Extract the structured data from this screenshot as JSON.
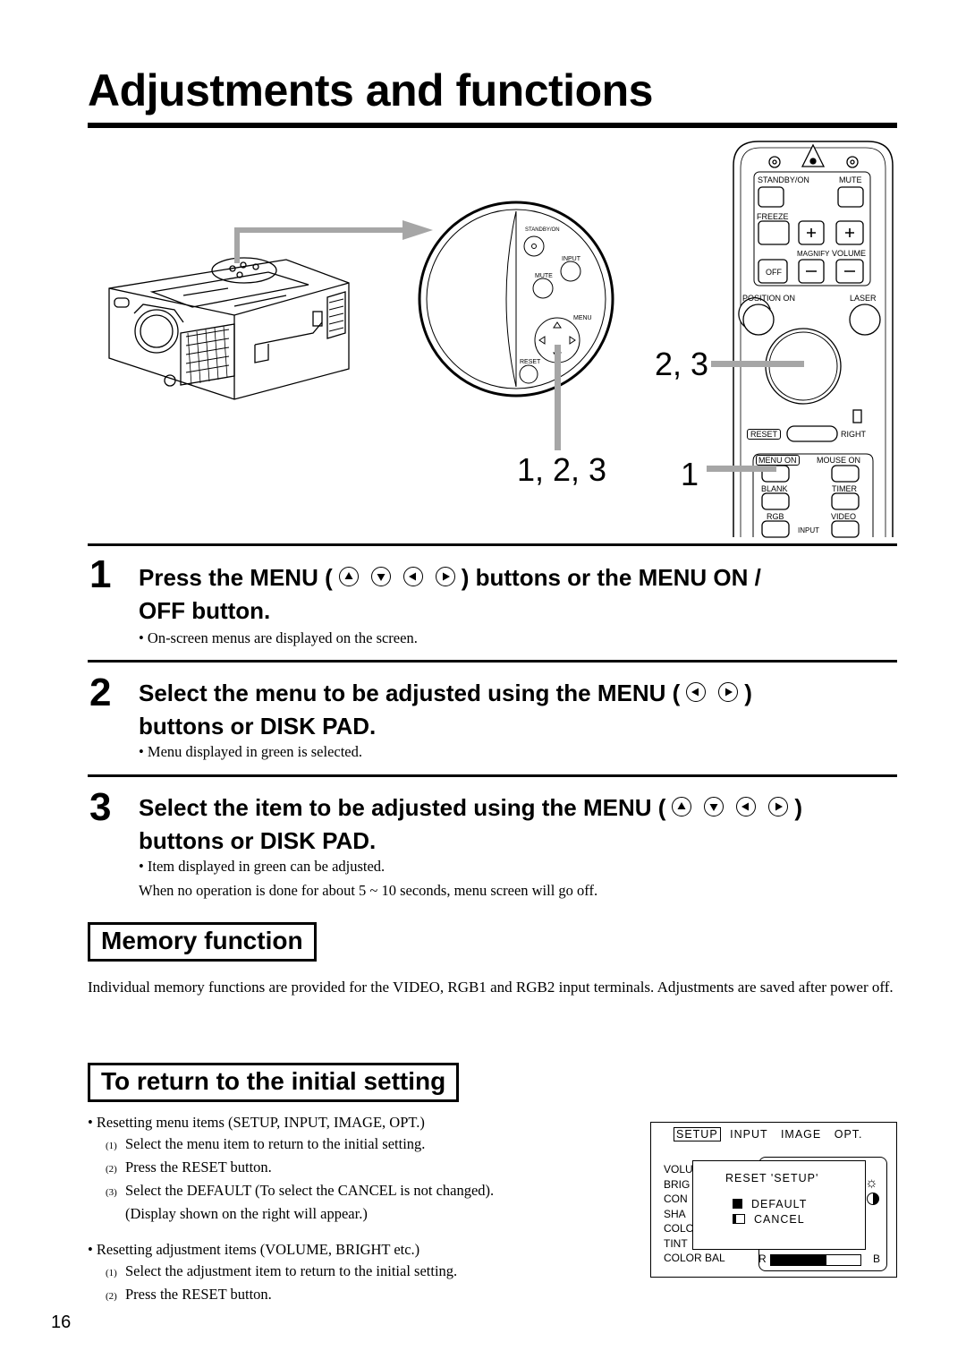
{
  "page": {
    "title": "Adjustments and functions",
    "page_number": "16"
  },
  "figure": {
    "callouts": {
      "panel": "1, 2, 3",
      "disk_pad": "2, 3",
      "menu_on": "1"
    },
    "panel_labels": {
      "standby_on": "STANDBY/ON",
      "input": "INPUT",
      "mute": "MUTE",
      "menu": "MENU",
      "reset": "RESET"
    },
    "remote_labels": {
      "standby_on": "STANDBY/ON",
      "mute": "MUTE",
      "freeze": "FREEZE",
      "off": "OFF",
      "magnify": "MAGNIFY",
      "volume": "VOLUME",
      "position_on": "POSITION  ON",
      "laser": "LASER",
      "reset": "RESET",
      "right": "RIGHT",
      "menu_on": "MENU ON",
      "mouse_on": "MOUSE  ON",
      "blank": "BLANK",
      "timer": "TIMER",
      "rgb": "RGB",
      "video": "VIDEO",
      "input": "INPUT"
    }
  },
  "steps": [
    {
      "number": "1",
      "heading_a": "Press the MENU (",
      "heading_b": ") buttons or the MENU ON /",
      "heading_line2": "OFF button.",
      "buttons": [
        "up",
        "down",
        "left",
        "right"
      ],
      "notes": [
        "• On-screen menus are displayed on the screen."
      ]
    },
    {
      "number": "2",
      "heading_a": "Select the menu to be adjusted using the MENU (",
      "heading_b": ")",
      "heading_line2": "buttons or DISK PAD.",
      "buttons": [
        "left",
        "right"
      ],
      "notes": [
        "• Menu displayed  in green is selected."
      ]
    },
    {
      "number": "3",
      "heading_a": "Select the item to be adjusted using the MENU (",
      "heading_b": ")",
      "heading_line2": "buttons or DISK PAD.",
      "buttons": [
        "up",
        "down",
        "left",
        "right"
      ],
      "notes": [
        "• Item displayed in green can be adjusted.",
        "When no operation is done for about 5 ~ 10 seconds, menu screen will go off."
      ]
    }
  ],
  "memory": {
    "heading": "Memory function",
    "body": "Individual memory functions are provided for the VIDEO, RGB1 and RGB2 input terminals. Adjustments are saved after power off."
  },
  "reset": {
    "heading": "To return to the initial setting",
    "menu_items": {
      "bullet": "• Resetting menu items (SETUP, INPUT, IMAGE, OPT.)",
      "steps": [
        {
          "n": "(1)",
          "text": "Select the menu item to return to the initial setting."
        },
        {
          "n": "(2)",
          "text": "Press the RESET  button."
        },
        {
          "n": "(3)",
          "text": "Select the DEFAULT (To select the CANCEL is not changed)."
        }
      ],
      "extra": "(Display shown on the right will appear.)"
    },
    "adjust_items": {
      "bullet": "• Resetting adjustment items (VOLUME, BRIGHT etc.)",
      "steps": [
        {
          "n": "(1)",
          "text": "Select the adjustment item to return to the initial setting."
        },
        {
          "n": "(2)",
          "text": "Press the RESET button."
        }
      ]
    }
  },
  "osd": {
    "tabs": [
      "SETUP",
      "INPUT",
      "IMAGE",
      "OPT."
    ],
    "selected_tab": "SETUP",
    "menu_rows": [
      "VOLU",
      "BRIG",
      "CON",
      "SHA",
      "COLO",
      "TINT",
      "COLOR BAL"
    ],
    "dialog_title": "RESET  'SETUP'",
    "options": [
      "DEFAULT",
      "CANCEL"
    ],
    "selected_option": "DEFAULT",
    "colorbal_left": "R",
    "colorbal_right": "B",
    "colorbal_fill": 0.62
  }
}
